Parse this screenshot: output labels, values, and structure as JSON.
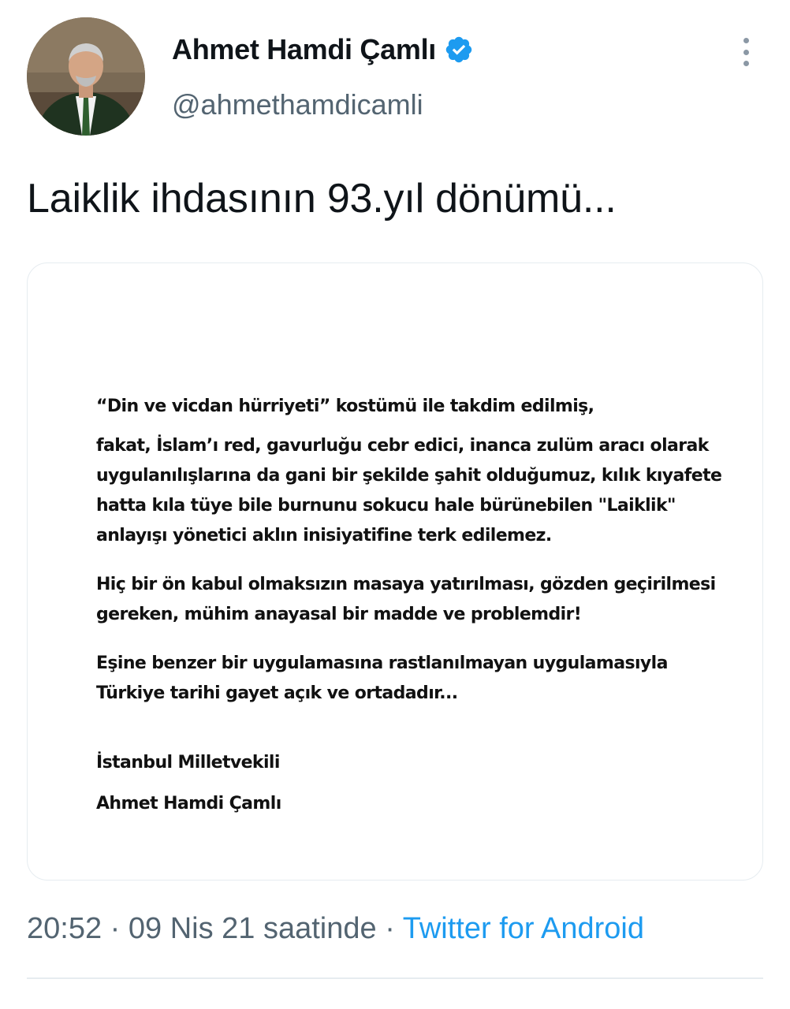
{
  "author": {
    "display_name": "Ahmet Hamdi Çamlı",
    "handle": "@ahmethamdicamli",
    "verified": true,
    "verified_color": "#1d9bf0"
  },
  "tweet": {
    "text": "Laiklik ihdasının 93.yıl dönümü...",
    "time": "20:52",
    "date": "09 Nis 21 saatinde",
    "separator": "·",
    "source": "Twitter for Android"
  },
  "media": {
    "lines": [
      "“Din ve vicdan hürriyeti” kostümü ile takdim edilmiş,",
      "fakat, İslam’ı red, gavurluğu cebr edici, inanca zulüm aracı olarak",
      "uygulanılışlarına da gani bir şekilde şahit olduğumuz, kılık kıyafete",
      "hatta kıla tüye bile burnunu sokucu hale bürünebilen \"Laiklik\"",
      "anlayışı yönetici aklın inisiyatifine terk edilemez.",
      "Hiç bir ön kabul olmaksızın masaya yatırılması, gözden geçirilmesi",
      "gereken, mühim anayasal bir madde ve problemdir!",
      "Eşine benzer bir uygulamasına rastlanılmayan uygulamasıyla",
      "Türkiye tarihi gayet açık ve ortadadır...",
      "İstanbul Milletvekili",
      "Ahmet Hamdi Çamlı"
    ]
  },
  "colors": {
    "text_primary": "#0f1419",
    "text_secondary": "#536471",
    "link": "#1d9bf0",
    "border": "#e6ecf0"
  },
  "icons": {
    "verified": "verified-badge-icon",
    "more": "more-vertical-icon"
  }
}
